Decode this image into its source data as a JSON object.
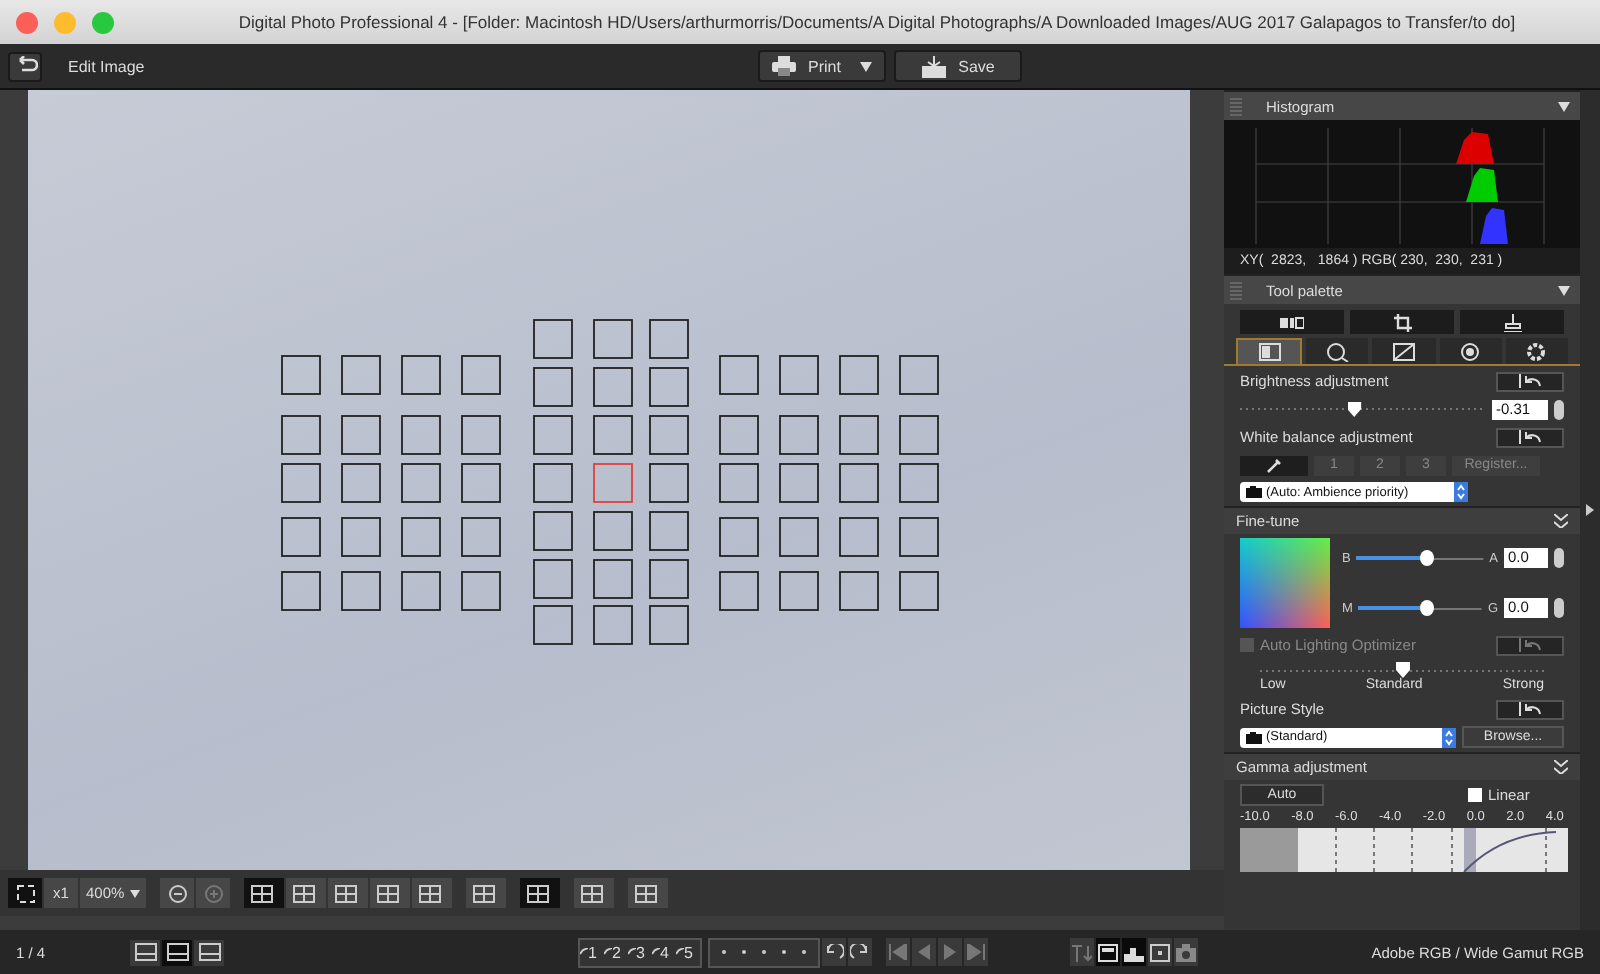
{
  "window": {
    "title": "Digital Photo Professional 4 - [Folder: Macintosh HD/Users/arthurmorris/Documents/A Digital Photographs/A Downloaded Images/AUG 2017 Galapagos to Transfer/to do]"
  },
  "toolbar": {
    "title": "Edit Image",
    "buttons": [
      {
        "kind": "print",
        "label": "Print",
        "has_menu": true
      },
      {
        "kind": "save",
        "label": "Save",
        "has_menu": false
      }
    ]
  },
  "viewer": {
    "zoom_ratio": "x1",
    "zoom_percent": "400%"
  },
  "histogram": {
    "title": "Histogram",
    "readout": "XY(  2823,   1864 ) RGB( 230,  230,  231 )"
  },
  "tool_palette": {
    "title": "Tool palette",
    "tabs": [
      {
        "kind": "basic",
        "selected": true
      },
      {
        "kind": "detail",
        "selected": false
      },
      {
        "kind": "tone",
        "selected": false
      },
      {
        "kind": "color",
        "selected": false
      },
      {
        "kind": "settings",
        "selected": false
      }
    ],
    "brightness": {
      "label": "Brightness adjustment",
      "level": 0.46,
      "value": "-0.31"
    },
    "white_balance": {
      "label": "White balance adjustment",
      "slots": [
        "1",
        "2",
        "3"
      ],
      "register": "Register...",
      "mode": "(Auto: Ambience priority)"
    }
  },
  "fine_tune": {
    "title": "Fine-tune",
    "sliders": [
      {
        "left": "B",
        "right": "A",
        "level": 0.55,
        "value": "0.0"
      },
      {
        "left": "M",
        "right": "G",
        "level": 0.55,
        "value": "0.0"
      }
    ],
    "alo": {
      "label": "Auto Lighting Optimizer",
      "checked": false,
      "disabled": true,
      "level": 0.5,
      "ticks": [
        "Low",
        "Standard",
        "Strong"
      ]
    },
    "picture_style": {
      "label": "Picture Style",
      "value": "(Standard)",
      "browse": "Browse..."
    }
  },
  "gamma": {
    "title": "Gamma adjustment",
    "auto": "Auto",
    "linear": {
      "label": "Linear",
      "checked": false
    },
    "scale": [
      "-10.0",
      "-8.0",
      "-6.0",
      "-4.0",
      "-2.0",
      "0.0",
      "2.0",
      "4.0"
    ]
  },
  "status_bar": {
    "page": "1 / 4",
    "view_modes": [
      {
        "selected": false
      },
      {
        "selected": true
      },
      {
        "selected": false
      }
    ],
    "ratings": [
      "1",
      "2",
      "3",
      "4",
      "5"
    ],
    "color_space": "Adobe RGB / Wide Gamut RGB"
  }
}
